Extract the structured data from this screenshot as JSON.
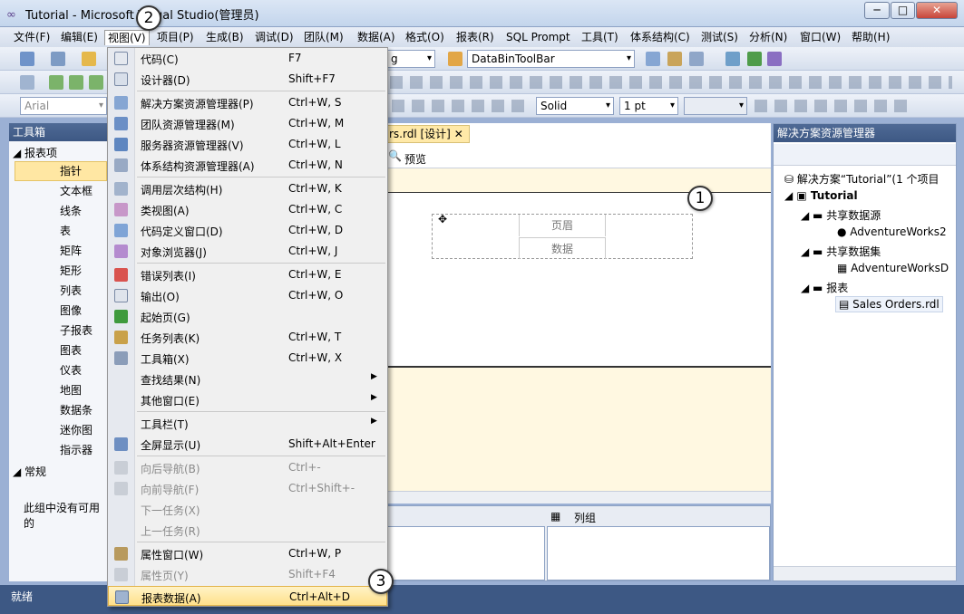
{
  "window": {
    "title": "Tutorial - Microsoft Visual Studio(管理员)",
    "min": "─",
    "max": "□",
    "close": "✕"
  },
  "menubar": [
    "文件(F)",
    "编辑(E)",
    "视图(V)",
    "项目(P)",
    "生成(B)",
    "调试(D)",
    "团队(M)",
    "数据(A)",
    "格式(O)",
    "报表(R)",
    "SQL Prompt",
    "工具(T)",
    "体系结构(C)",
    "测试(S)",
    "分析(N)",
    "窗口(W)",
    "帮助(H)"
  ],
  "toolbar": {
    "config_combo": "g",
    "databin_combo": "DataBinToolBar",
    "font_combo": "Arial",
    "line_style": "Solid",
    "line_width": "1 pt"
  },
  "toolbox": {
    "title": "工具箱",
    "section_report": "报表项",
    "items": [
      "指针",
      "文本框",
      "线条",
      "表",
      "矩阵",
      "矩形",
      "列表",
      "图像",
      "子报表",
      "图表",
      "仪表",
      "地图",
      "数据条",
      "迷你图",
      "指示器"
    ],
    "section_general": "常规",
    "empty_msg": "此组中没有可用的"
  },
  "designer": {
    "tab_label": "rs.rdl [设计]",
    "preview_label": "预览",
    "header_cell": "页眉",
    "data_cell": "数据",
    "column_group": "列组"
  },
  "solution": {
    "title": "解决方案资源管理器",
    "root": "解决方案“Tutorial”(1 个项目",
    "project": "Tutorial",
    "shared_ds": "共享数据源",
    "ds_item": "AdventureWorks2",
    "shared_dset": "共享数据集",
    "dset_item": "AdventureWorksD",
    "reports": "报表",
    "report_item": "Sales Orders.rdl"
  },
  "status": {
    "text": "就绪"
  },
  "view_menu": [
    {
      "label": "代码(C)",
      "shortcut": "F7"
    },
    {
      "label": "设计器(D)",
      "shortcut": "Shift+F7"
    },
    {
      "label": "解决方案资源管理器(P)",
      "shortcut": "Ctrl+W, S"
    },
    {
      "label": "团队资源管理器(M)",
      "shortcut": "Ctrl+W, M"
    },
    {
      "label": "服务器资源管理器(V)",
      "shortcut": "Ctrl+W, L"
    },
    {
      "label": "体系结构资源管理器(A)",
      "shortcut": "Ctrl+W, N"
    },
    {
      "label": "调用层次结构(H)",
      "shortcut": "Ctrl+W, K"
    },
    {
      "label": "类视图(A)",
      "shortcut": "Ctrl+W, C"
    },
    {
      "label": "代码定义窗口(D)",
      "shortcut": "Ctrl+W, D"
    },
    {
      "label": "对象浏览器(J)",
      "shortcut": "Ctrl+W, J"
    },
    {
      "label": "错误列表(I)",
      "shortcut": "Ctrl+W, E"
    },
    {
      "label": "输出(O)",
      "shortcut": "Ctrl+W, O"
    },
    {
      "label": "起始页(G)",
      "shortcut": ""
    },
    {
      "label": "任务列表(K)",
      "shortcut": "Ctrl+W, T"
    },
    {
      "label": "工具箱(X)",
      "shortcut": "Ctrl+W, X"
    },
    {
      "label": "查找结果(N)",
      "shortcut": ""
    },
    {
      "label": "其他窗口(E)",
      "shortcut": ""
    },
    {
      "label": "工具栏(T)",
      "shortcut": ""
    },
    {
      "label": "全屏显示(U)",
      "shortcut": "Shift+Alt+Enter"
    },
    {
      "label": "向后导航(B)",
      "shortcut": "Ctrl+-"
    },
    {
      "label": "向前导航(F)",
      "shortcut": "Ctrl+Shift+-"
    },
    {
      "label": "下一任务(X)",
      "shortcut": ""
    },
    {
      "label": "上一任务(R)",
      "shortcut": ""
    },
    {
      "label": "属性窗口(W)",
      "shortcut": "Ctrl+W, P"
    },
    {
      "label": "属性页(Y)",
      "shortcut": "Shift+F4"
    },
    {
      "label": "报表数据(A)",
      "shortcut": "Ctrl+Alt+D"
    }
  ],
  "callouts": [
    "1",
    "2",
    "3"
  ]
}
